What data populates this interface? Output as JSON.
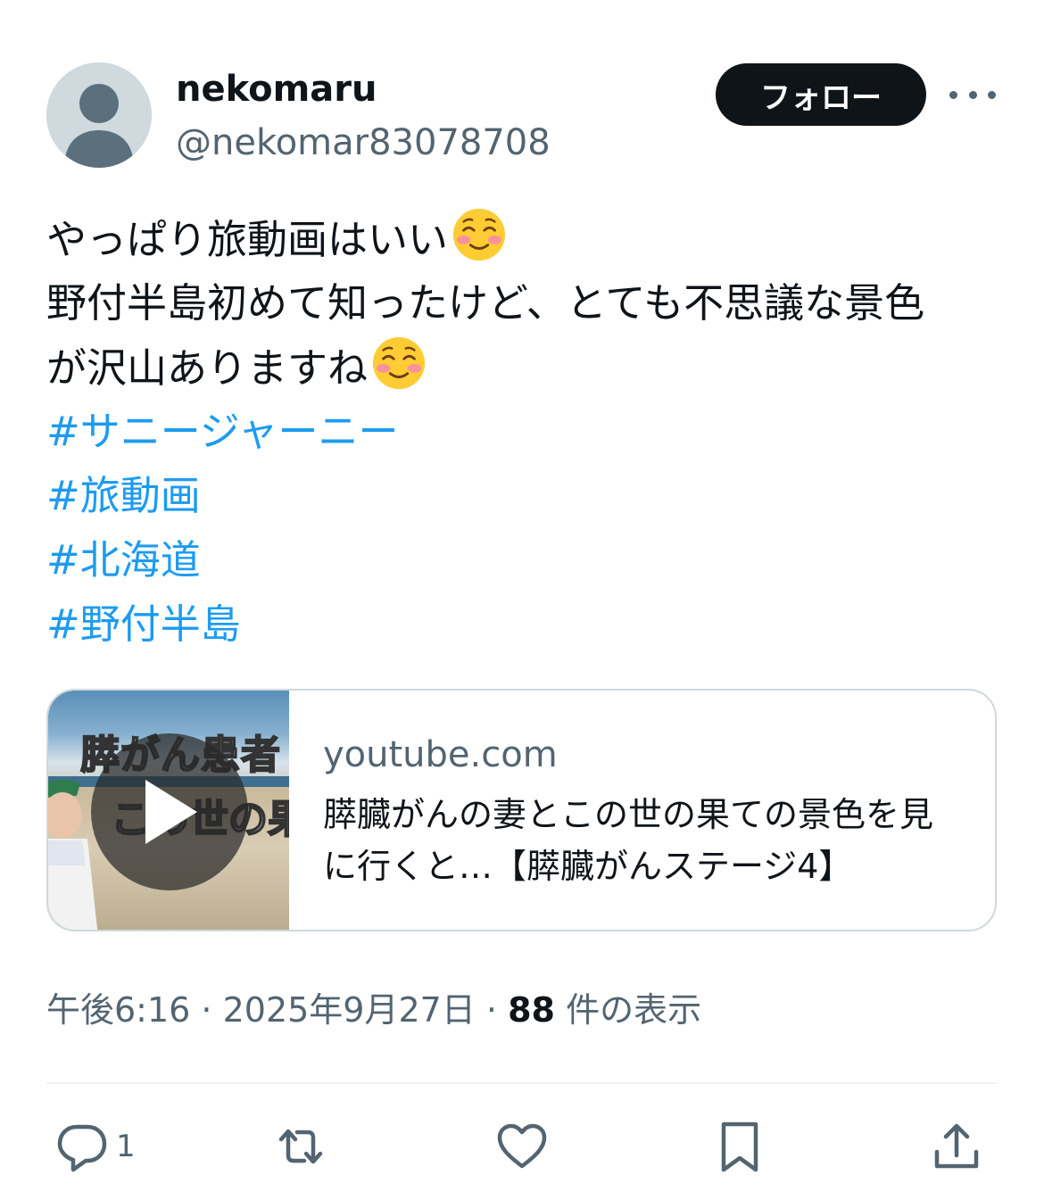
{
  "author": {
    "display_name": "nekomaru",
    "handle": "@nekomar83078708",
    "avatar_icon": "default-avatar-icon"
  },
  "header": {
    "follow_label": "フォロー",
    "more_icon": "more-icon"
  },
  "post": {
    "line1": "やっぱり旅動画はいい",
    "line2": "野付半島初めて知ったけど、とても不思議な景色",
    "line3": "が沢山ありますね",
    "emoji": "smiling-face-with-blush-emoji",
    "hashtags": [
      "#サニージャーニー",
      "#旅動画",
      "#北海道",
      "#野付半島"
    ]
  },
  "card": {
    "domain": "youtube.com",
    "title": "膵臓がんの妻とこの世の果ての景色を見に行くと…【膵臓がんステージ4】",
    "thumbnail_text_1": "膵がん患者",
    "thumbnail_text_2": "この世の果",
    "play_icon": "play-icon"
  },
  "meta": {
    "time": "午後6:16",
    "separator": " · ",
    "date": "2025年9月27日",
    "views_count": "88",
    "views_label": " 件の表示"
  },
  "actions": {
    "reply_count": "1",
    "icons": [
      "reply-icon",
      "repost-icon",
      "like-icon",
      "bookmark-icon",
      "share-icon"
    ]
  },
  "colors": {
    "accent": "#1d9bf0",
    "text": "#0f1419",
    "secondary": "#536471",
    "border": "#cfd9de"
  }
}
